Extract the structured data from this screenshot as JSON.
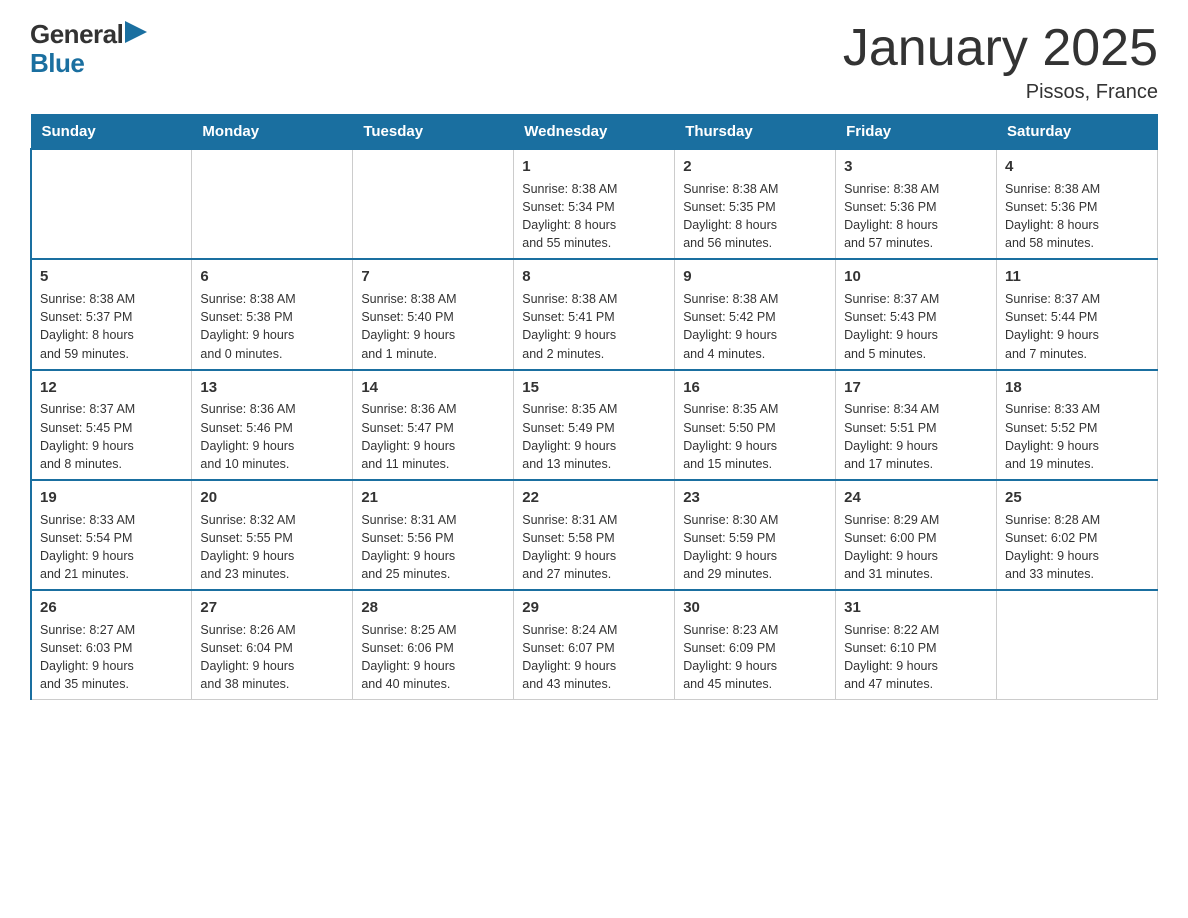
{
  "header": {
    "logo_general": "General",
    "logo_blue": "Blue",
    "month_title": "January 2025",
    "location": "Pissos, France"
  },
  "calendar": {
    "days_of_week": [
      "Sunday",
      "Monday",
      "Tuesday",
      "Wednesday",
      "Thursday",
      "Friday",
      "Saturday"
    ],
    "weeks": [
      [
        {
          "day": "",
          "info": ""
        },
        {
          "day": "",
          "info": ""
        },
        {
          "day": "",
          "info": ""
        },
        {
          "day": "1",
          "info": "Sunrise: 8:38 AM\nSunset: 5:34 PM\nDaylight: 8 hours\nand 55 minutes."
        },
        {
          "day": "2",
          "info": "Sunrise: 8:38 AM\nSunset: 5:35 PM\nDaylight: 8 hours\nand 56 minutes."
        },
        {
          "day": "3",
          "info": "Sunrise: 8:38 AM\nSunset: 5:36 PM\nDaylight: 8 hours\nand 57 minutes."
        },
        {
          "day": "4",
          "info": "Sunrise: 8:38 AM\nSunset: 5:36 PM\nDaylight: 8 hours\nand 58 minutes."
        }
      ],
      [
        {
          "day": "5",
          "info": "Sunrise: 8:38 AM\nSunset: 5:37 PM\nDaylight: 8 hours\nand 59 minutes."
        },
        {
          "day": "6",
          "info": "Sunrise: 8:38 AM\nSunset: 5:38 PM\nDaylight: 9 hours\nand 0 minutes."
        },
        {
          "day": "7",
          "info": "Sunrise: 8:38 AM\nSunset: 5:40 PM\nDaylight: 9 hours\nand 1 minute."
        },
        {
          "day": "8",
          "info": "Sunrise: 8:38 AM\nSunset: 5:41 PM\nDaylight: 9 hours\nand 2 minutes."
        },
        {
          "day": "9",
          "info": "Sunrise: 8:38 AM\nSunset: 5:42 PM\nDaylight: 9 hours\nand 4 minutes."
        },
        {
          "day": "10",
          "info": "Sunrise: 8:37 AM\nSunset: 5:43 PM\nDaylight: 9 hours\nand 5 minutes."
        },
        {
          "day": "11",
          "info": "Sunrise: 8:37 AM\nSunset: 5:44 PM\nDaylight: 9 hours\nand 7 minutes."
        }
      ],
      [
        {
          "day": "12",
          "info": "Sunrise: 8:37 AM\nSunset: 5:45 PM\nDaylight: 9 hours\nand 8 minutes."
        },
        {
          "day": "13",
          "info": "Sunrise: 8:36 AM\nSunset: 5:46 PM\nDaylight: 9 hours\nand 10 minutes."
        },
        {
          "day": "14",
          "info": "Sunrise: 8:36 AM\nSunset: 5:47 PM\nDaylight: 9 hours\nand 11 minutes."
        },
        {
          "day": "15",
          "info": "Sunrise: 8:35 AM\nSunset: 5:49 PM\nDaylight: 9 hours\nand 13 minutes."
        },
        {
          "day": "16",
          "info": "Sunrise: 8:35 AM\nSunset: 5:50 PM\nDaylight: 9 hours\nand 15 minutes."
        },
        {
          "day": "17",
          "info": "Sunrise: 8:34 AM\nSunset: 5:51 PM\nDaylight: 9 hours\nand 17 minutes."
        },
        {
          "day": "18",
          "info": "Sunrise: 8:33 AM\nSunset: 5:52 PM\nDaylight: 9 hours\nand 19 minutes."
        }
      ],
      [
        {
          "day": "19",
          "info": "Sunrise: 8:33 AM\nSunset: 5:54 PM\nDaylight: 9 hours\nand 21 minutes."
        },
        {
          "day": "20",
          "info": "Sunrise: 8:32 AM\nSunset: 5:55 PM\nDaylight: 9 hours\nand 23 minutes."
        },
        {
          "day": "21",
          "info": "Sunrise: 8:31 AM\nSunset: 5:56 PM\nDaylight: 9 hours\nand 25 minutes."
        },
        {
          "day": "22",
          "info": "Sunrise: 8:31 AM\nSunset: 5:58 PM\nDaylight: 9 hours\nand 27 minutes."
        },
        {
          "day": "23",
          "info": "Sunrise: 8:30 AM\nSunset: 5:59 PM\nDaylight: 9 hours\nand 29 minutes."
        },
        {
          "day": "24",
          "info": "Sunrise: 8:29 AM\nSunset: 6:00 PM\nDaylight: 9 hours\nand 31 minutes."
        },
        {
          "day": "25",
          "info": "Sunrise: 8:28 AM\nSunset: 6:02 PM\nDaylight: 9 hours\nand 33 minutes."
        }
      ],
      [
        {
          "day": "26",
          "info": "Sunrise: 8:27 AM\nSunset: 6:03 PM\nDaylight: 9 hours\nand 35 minutes."
        },
        {
          "day": "27",
          "info": "Sunrise: 8:26 AM\nSunset: 6:04 PM\nDaylight: 9 hours\nand 38 minutes."
        },
        {
          "day": "28",
          "info": "Sunrise: 8:25 AM\nSunset: 6:06 PM\nDaylight: 9 hours\nand 40 minutes."
        },
        {
          "day": "29",
          "info": "Sunrise: 8:24 AM\nSunset: 6:07 PM\nDaylight: 9 hours\nand 43 minutes."
        },
        {
          "day": "30",
          "info": "Sunrise: 8:23 AM\nSunset: 6:09 PM\nDaylight: 9 hours\nand 45 minutes."
        },
        {
          "day": "31",
          "info": "Sunrise: 8:22 AM\nSunset: 6:10 PM\nDaylight: 9 hours\nand 47 minutes."
        },
        {
          "day": "",
          "info": ""
        }
      ]
    ]
  }
}
